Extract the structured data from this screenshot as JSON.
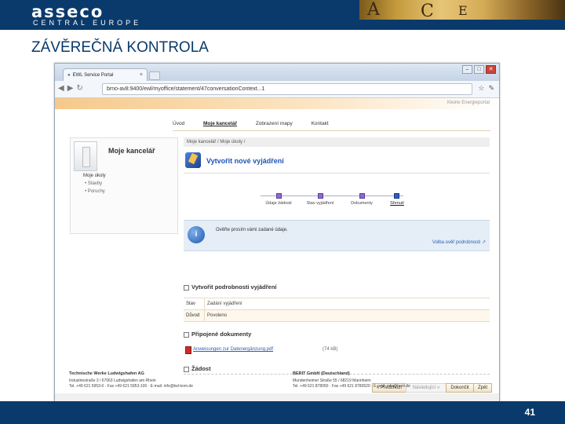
{
  "header": {
    "logo": "asseco",
    "logo_sub": "CENTRAL EUROPE",
    "photo_letters": [
      "A",
      "C",
      "E"
    ]
  },
  "slide": {
    "title": "ZÁVĚREČNÁ KONTROLA",
    "page_number": "41"
  },
  "browser": {
    "tab_title": "EWL Service Portal",
    "url": "brno-av8:9400/ewl/myoffice/statement/47conversationContext...1",
    "window_controls": [
      "–",
      "□",
      "✕"
    ],
    "toolbar_icons": [
      "back-icon",
      "forward-icon",
      "reload-icon",
      "star-icon",
      "wrench-icon"
    ]
  },
  "portal": {
    "org_link": "Kleine Energieportal",
    "nav": [
      "Úvod",
      "Moje kancelář",
      "Zobrazení mapy",
      "Kontakt"
    ],
    "nav_active": "Moje kancelář",
    "sidebar": {
      "title": "Moje kancelář",
      "items": [
        "Moje úkoly",
        "Stavby",
        "Poruchy"
      ]
    },
    "breadcrumb": "Moje kancelář / Moje úkoly /",
    "heading": "Vytvořit nové vyjádření",
    "steps": [
      "Údaje žádosti",
      "Stav vyjádření",
      "Dokumenty",
      "Shrnutí"
    ],
    "current_step": "Shrnutí",
    "info": {
      "text": "Ověřte prosím vámi zadané údaje.",
      "link": "Volba ověř podrobnosti ↗"
    },
    "section_details": "Vytvořit podrobnosti vyjádření",
    "details": [
      {
        "key": "Stav",
        "value": "Zadání vyjádření"
      },
      {
        "key": "Důvod",
        "value": "Povoleno"
      }
    ],
    "section_attachments": "Připojené dokumenty",
    "attachment": {
      "name": "Anweisungen zur Datenergänzung.pdf",
      "size": "(74 kB)"
    },
    "section_request": "Žádost",
    "buttons": {
      "prev": "« Předchozí",
      "next": "Následující »",
      "finish": "Dokončit",
      "back": "Zpět"
    },
    "footer": {
      "left": {
        "name": "Technische Werke Ludwigshafen AG",
        "address": "Industriestraße 3 / 67063 Ludwigshafen am Rhein",
        "contact": "Tel. +49 621 5953-0 · Fax +49 621 5953-100 · E-mail: info@twl-kom.de"
      },
      "right": {
        "name": "BERIT GmbH (Deutschland)",
        "address": "Mundenheimer Straße 55 / 68219 Mannheim",
        "contact": "Tel. +49 621 878050 · Fax +49 621 8780520 · E-mail: info@berit.de"
      }
    }
  }
}
